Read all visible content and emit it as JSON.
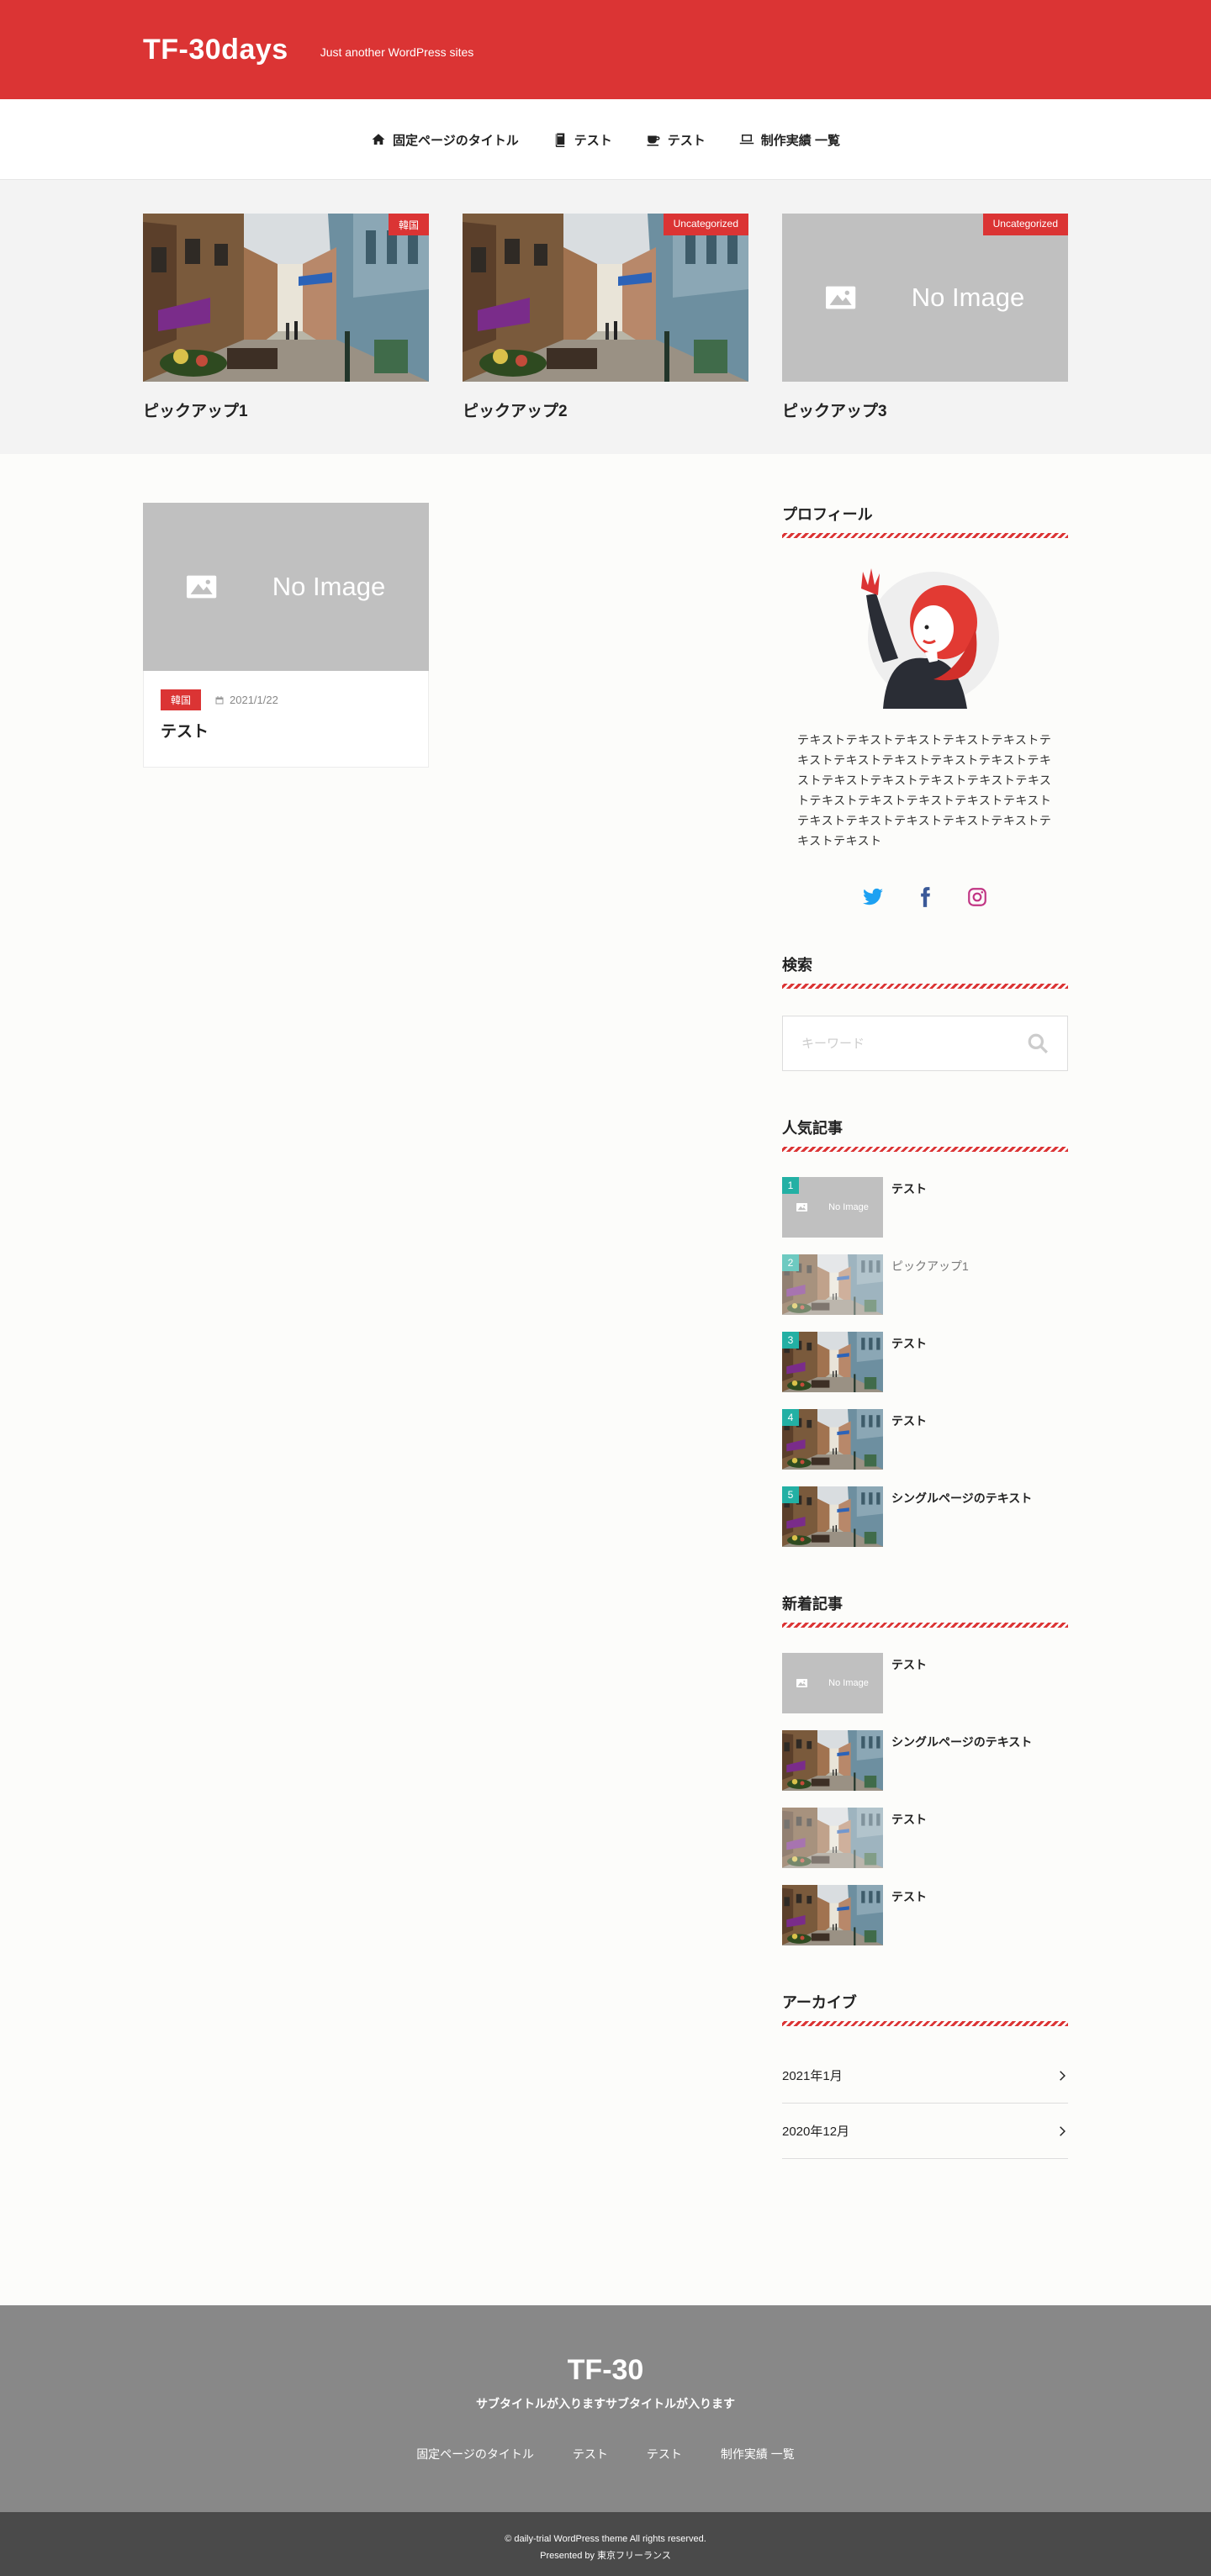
{
  "header": {
    "site_title": "TF-30days",
    "description": "Just another WordPress sites"
  },
  "nav": {
    "items": [
      {
        "label": "固定ページのタイトル",
        "icon": "home-icon"
      },
      {
        "label": "テスト",
        "icon": "book-icon"
      },
      {
        "label": "テスト",
        "icon": "coffee-icon"
      },
      {
        "label": "制作実績 一覧",
        "icon": "laptop-icon"
      }
    ]
  },
  "pickup": [
    {
      "title": "ピックアップ1",
      "category": "韓国",
      "image": "street-photo"
    },
    {
      "title": "ピックアップ2",
      "category": "Uncategorized",
      "image": "street-photo"
    },
    {
      "title": "ピックアップ3",
      "category": "Uncategorized",
      "image": "no-image"
    }
  ],
  "no_image_label": "No Image",
  "posts": [
    {
      "title": "テスト",
      "category": "韓国",
      "date": "2021/1/22",
      "image": "no-image"
    }
  ],
  "sidebar": {
    "profile": {
      "title": "プロフィール",
      "text": "テキストテキストテキストテキストテキストテキストテキストテキストテキストテキストテキストテキストテキストテキストテキストテキストテキストテキストテキストテキストテキストテキストテキストテキストテキストテキストテキストテキスト"
    },
    "search": {
      "title": "検索",
      "placeholder": "キーワード"
    },
    "popular": {
      "title": "人気記事",
      "items": [
        {
          "rank": "1",
          "title": "テスト",
          "image": "no-image",
          "style": "bold"
        },
        {
          "rank": "2",
          "title": "ピックアップ1",
          "image": "street-photo",
          "style": "light"
        },
        {
          "rank": "3",
          "title": "テスト",
          "image": "street-photo",
          "style": "bold"
        },
        {
          "rank": "4",
          "title": "テスト",
          "image": "street-photo",
          "style": "bold"
        },
        {
          "rank": "5",
          "title": "シングルページのテキスト",
          "image": "street-photo",
          "style": "bold"
        }
      ]
    },
    "recent": {
      "title": "新着記事",
      "items": [
        {
          "title": "テスト",
          "image": "no-image"
        },
        {
          "title": "シングルページのテキスト",
          "image": "street-photo"
        },
        {
          "title": "テスト",
          "image": "street-photo"
        },
        {
          "title": "テスト",
          "image": "street-photo"
        }
      ]
    },
    "archive": {
      "title": "アーカイブ",
      "items": [
        "2021年1月",
        "2020年12月"
      ]
    }
  },
  "footer": {
    "title": "TF-30",
    "subtitle": "サブタイトルが入りますサブタイトルが入ります",
    "nav": [
      "固定ページのタイトル",
      "テスト",
      "テスト",
      "制作実績 一覧"
    ],
    "copyright": "© daily-trial WordPress theme All rights reserved.",
    "presented": "Presented by 東京フリーランス"
  },
  "colors": {
    "accent": "#db3434",
    "rank_badge": "#23b0a4",
    "footer_bg": "#888888",
    "copyright_bg": "#4a4a4a"
  }
}
